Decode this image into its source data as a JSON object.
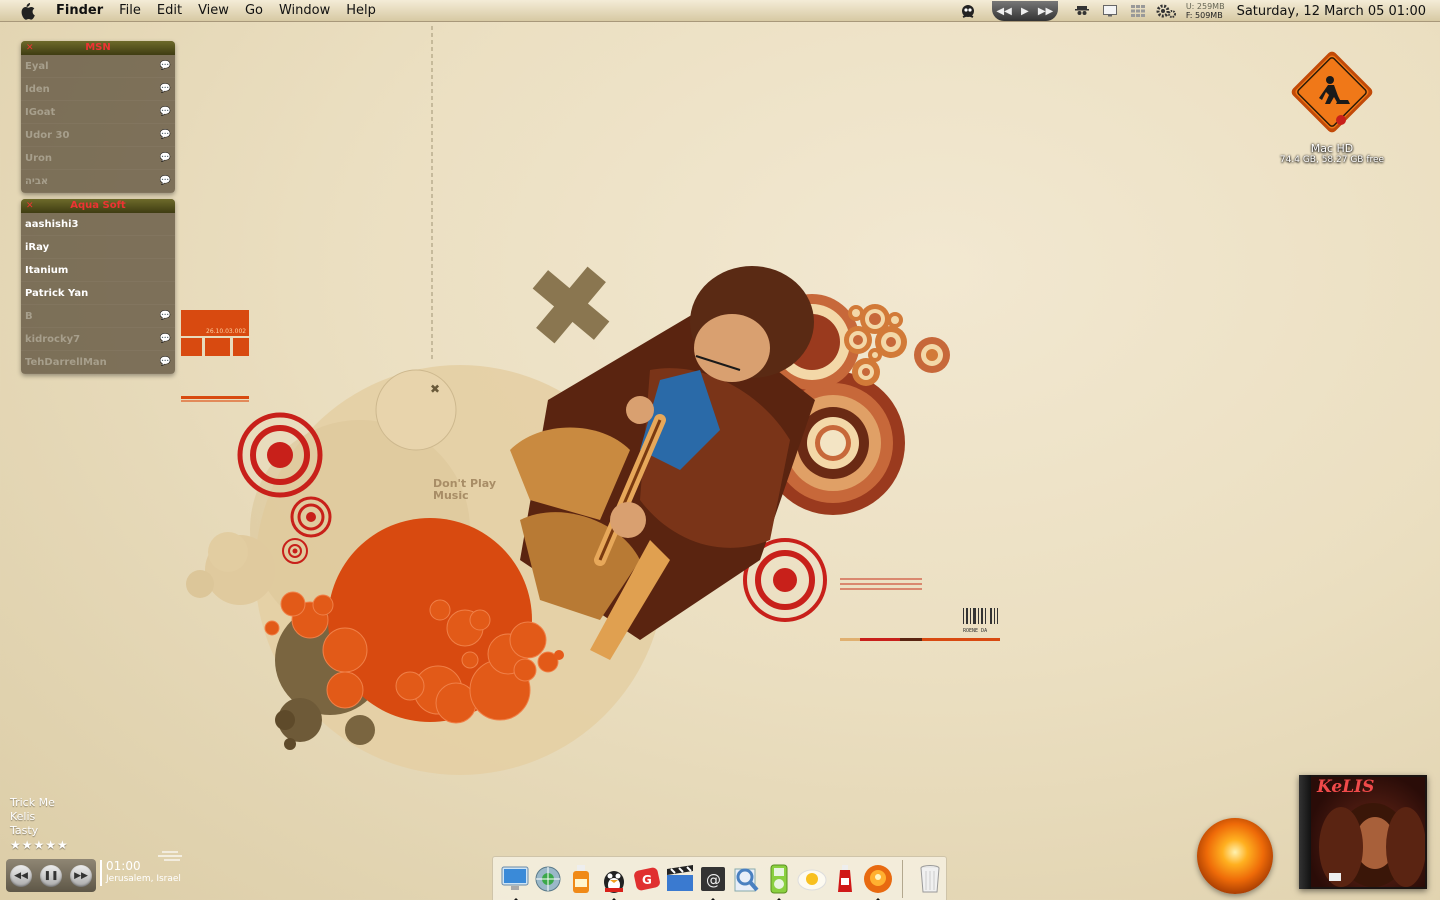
{
  "menubar": {
    "app_name": "Finder",
    "items": [
      "File",
      "Edit",
      "View",
      "Go",
      "Window",
      "Help"
    ],
    "memory_used": "U: 259MB",
    "memory_free": "F: 509MB",
    "clock": "Saturday, 12 March 05  01:00"
  },
  "msn_panel": {
    "title": "MSN",
    "buddies": [
      {
        "name": "Eyal",
        "status": "offline"
      },
      {
        "name": "Iden",
        "status": "offline"
      },
      {
        "name": "IGoat",
        "status": "offline"
      },
      {
        "name": "Udor 30",
        "status": "offline"
      },
      {
        "name": "Uron",
        "status": "offline"
      },
      {
        "name": "אביה",
        "status": "offline"
      }
    ]
  },
  "aquasoft_panel": {
    "title": "Aqua Soft",
    "buddies": [
      {
        "name": "aashishi3",
        "status": "online"
      },
      {
        "name": "iRay",
        "status": "online"
      },
      {
        "name": "Itanium",
        "status": "online"
      },
      {
        "name": "Patrick Yan",
        "status": "online"
      },
      {
        "name": "B",
        "status": "offline"
      },
      {
        "name": "kidrocky7",
        "status": "offline"
      },
      {
        "name": "TehDarrellMan",
        "status": "offline"
      }
    ]
  },
  "drive": {
    "label": "Mac HD",
    "info": "74.4 GB, 58.27 GB free"
  },
  "wallpaper": {
    "slogan_line1": "Don't Play",
    "slogan_line2": "Music",
    "date_stamp": "26.10.03.002",
    "barcode_text": "ROENE DA"
  },
  "now_playing": {
    "track": "Trick Me",
    "artist": "Kelis",
    "album": "Tasty",
    "rating": "★★★★★"
  },
  "weather": {
    "time": "01:00",
    "location": "Jerusalem, Israel"
  },
  "album_cover": {
    "title": "KeLIS"
  },
  "dock": {
    "icons": [
      {
        "name": "finder-icon",
        "running": true
      },
      {
        "name": "network-icon",
        "running": false
      },
      {
        "name": "orange-bottle-icon",
        "running": false
      },
      {
        "name": "adium-duck-icon",
        "running": true
      },
      {
        "name": "red-app-icon",
        "running": false
      },
      {
        "name": "clapper-icon",
        "running": false
      },
      {
        "name": "mail-icon",
        "running": true
      },
      {
        "name": "preview-icon",
        "running": false
      },
      {
        "name": "ipod-icon",
        "running": true
      },
      {
        "name": "egg-icon",
        "running": false
      },
      {
        "name": "ketchup-icon",
        "running": false
      },
      {
        "name": "orange-orb-icon",
        "running": true
      }
    ],
    "trash": "trash-icon"
  },
  "colors": {
    "accent_red": "#c8201a",
    "accent_orange": "#d84a10",
    "brown": "#6a3a20",
    "wallpaper": "#ebdfc1"
  }
}
